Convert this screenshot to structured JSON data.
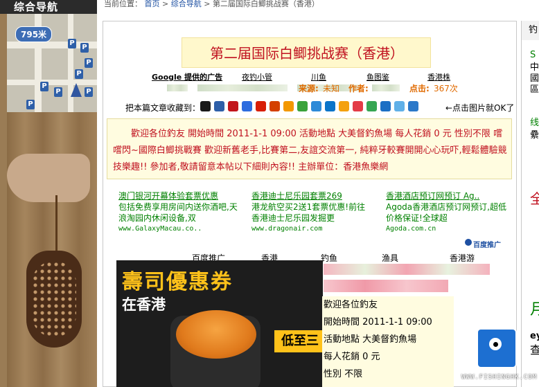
{
  "left_ad": {
    "site_label": "综合导航",
    "map_distance": "795米",
    "map_pins": [
      "P",
      "P",
      "P",
      "P",
      "P",
      "P",
      "P",
      "P"
    ]
  },
  "breadcrumb": {
    "prefix": "当前位置：",
    "home": "首页",
    "sep": ">",
    "category": "综合导航",
    "current": "第二届国际白鲫挑战赛（香港）"
  },
  "article": {
    "title": "第二届国际白鲫挑战赛（香港）",
    "title_color": "#c0111f"
  },
  "meta": {
    "google_ads_label": "Google 提供的广告",
    "links": [
      "夜钓小管",
      "川鱼",
      "鱼图鉴",
      "香港株"
    ],
    "source_key": "来源:",
    "source_value": "未知",
    "author_key": "作者:",
    "clicks_key": "点击:",
    "clicks_value": "367次"
  },
  "bookmark": {
    "label": "把本篇文章收藏到：",
    "hint": "←点击图片就OK了",
    "icons": [
      {
        "name": "qq-icon",
        "color": "#1a1a1a"
      },
      {
        "name": "baidu-icon",
        "color": "#2e5fa8"
      },
      {
        "name": "yahoo-icon",
        "color": "#c2151c"
      },
      {
        "name": "google-icon",
        "color": "#2d6cdf"
      },
      {
        "name": "sina-icon",
        "color": "#d81e06"
      },
      {
        "name": "163-icon",
        "color": "#d44000"
      },
      {
        "name": "sohu-icon",
        "color": "#f39800"
      },
      {
        "name": "hexun-icon",
        "color": "#3aa23a"
      },
      {
        "name": "diglog-icon",
        "color": "#2d8ad8"
      },
      {
        "name": "wozhao-icon",
        "color": "#0a74c9"
      },
      {
        "name": "digu-icon",
        "color": "#f4a10f"
      },
      {
        "name": "shoucang-icon",
        "color": "#e33b47"
      },
      {
        "name": "yesky-icon",
        "color": "#36a653"
      },
      {
        "name": "mop-icon",
        "color": "#1c6fc4"
      },
      {
        "name": "fanfou-icon",
        "color": "#60b0e8"
      },
      {
        "name": "ie-favorites-icon",
        "color": "#2c79c9"
      }
    ]
  },
  "intro": {
    "text": "歡迎各位釣友 開始時間 2011-1-1 09:00 活動地點 大美督釣魚場 每人花銷 0 元 性別不限 嚐嚐閃~國際白鯽挑戰賽 歡迎新舊老手,比賽第二,友誼交流第一, 純粹牙較賽開開心心玩吓,輕鬆體驗競技樂趣!! 參加者,敬請留意本帖以下細則內容!! 主辦單位：香港魚樂網"
  },
  "ads": [
    {
      "title": "澳门银河开幕体验套票优惠",
      "desc": "包括免费享用房间内送你酒吧,天浪淘园内休闲设备,双",
      "url": "www.GalaxyMacau.co.."
    },
    {
      "title": "香港迪士尼乐园套票269",
      "desc": "港龙航空买2送1套票优惠!前往香港迪士尼乐园发掘更",
      "url": "www.dragonair.com"
    },
    {
      "title": "香港酒店预订网预订 Ag..",
      "desc": "Agoda香港酒店预订网预订,超低价格保证!全球超",
      "url": "Agoda.com.cn"
    }
  ],
  "baidu_promo": "百度推广",
  "tags": [
    "百度推广",
    "香港",
    "钓鱼",
    "渔具",
    "香港游"
  ],
  "sushi_ad": {
    "title": "壽司優惠券",
    "subtitle": "在香港",
    "price": "低至三"
  },
  "detail": {
    "lines": [
      "歡迎各位釣友",
      "開始時間 2011-1-1 09:00",
      "活動地點 大美督釣魚場",
      "每人花銷 0 元",
      "性別 不限"
    ]
  },
  "right_col": {
    "head": "钓",
    "frags": [
      "S",
      "中",
      "國",
      "區",
      "线",
      "纍",
      "全",
      "月",
      "ey",
      "查"
    ]
  },
  "watermark": "WWW.FISHINGHK.COM"
}
